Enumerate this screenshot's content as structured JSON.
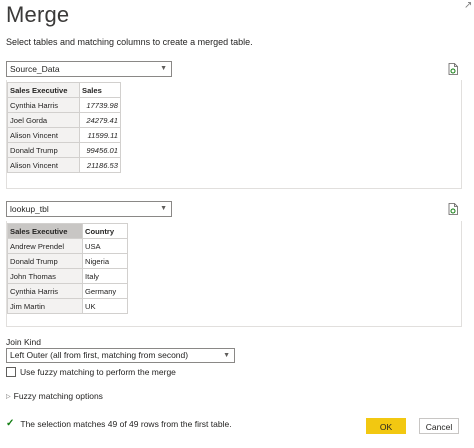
{
  "dialog": {
    "title": "Merge",
    "subtitle": "Select tables and matching columns to create a merged table."
  },
  "table1": {
    "selected": "Source_Data",
    "headers": [
      "Sales Executive",
      "Sales"
    ],
    "rows": [
      [
        "Cynthia Harris",
        "17739.98"
      ],
      [
        "Joel Gorda",
        "24279.41"
      ],
      [
        "Alison Vincent",
        "11599.11"
      ],
      [
        "Donald Trump",
        "99456.01"
      ],
      [
        "Alison Vincent",
        "21186.53"
      ]
    ]
  },
  "table2": {
    "selected": "lookup_tbl",
    "headers": [
      "Sales Executive",
      "Country"
    ],
    "rows": [
      [
        "Andrew Prendel",
        "USA"
      ],
      [
        "Donald Trump",
        "Nigeria"
      ],
      [
        "John Thomas",
        "Italy"
      ],
      [
        "Cynthia Harris",
        "Germany"
      ],
      [
        "Jim Martin",
        "UK"
      ]
    ]
  },
  "join": {
    "label": "Join Kind",
    "selected": "Left Outer (all from first, matching from second)"
  },
  "fuzzy": {
    "checkbox_label": "Use fuzzy matching to perform the merge",
    "options_label": "Fuzzy matching options"
  },
  "status": {
    "message": "The selection matches 49 of 49 rows from the first table."
  },
  "buttons": {
    "ok": "OK",
    "cancel": "Cancel"
  },
  "colors": {
    "accent": "#f2c811",
    "success": "#107c10"
  },
  "icons": {
    "file_refresh": "file-refresh-icon",
    "dropdown": "chevron-down-icon",
    "expand": "triangle-right-icon",
    "status": "checkmark-icon"
  }
}
